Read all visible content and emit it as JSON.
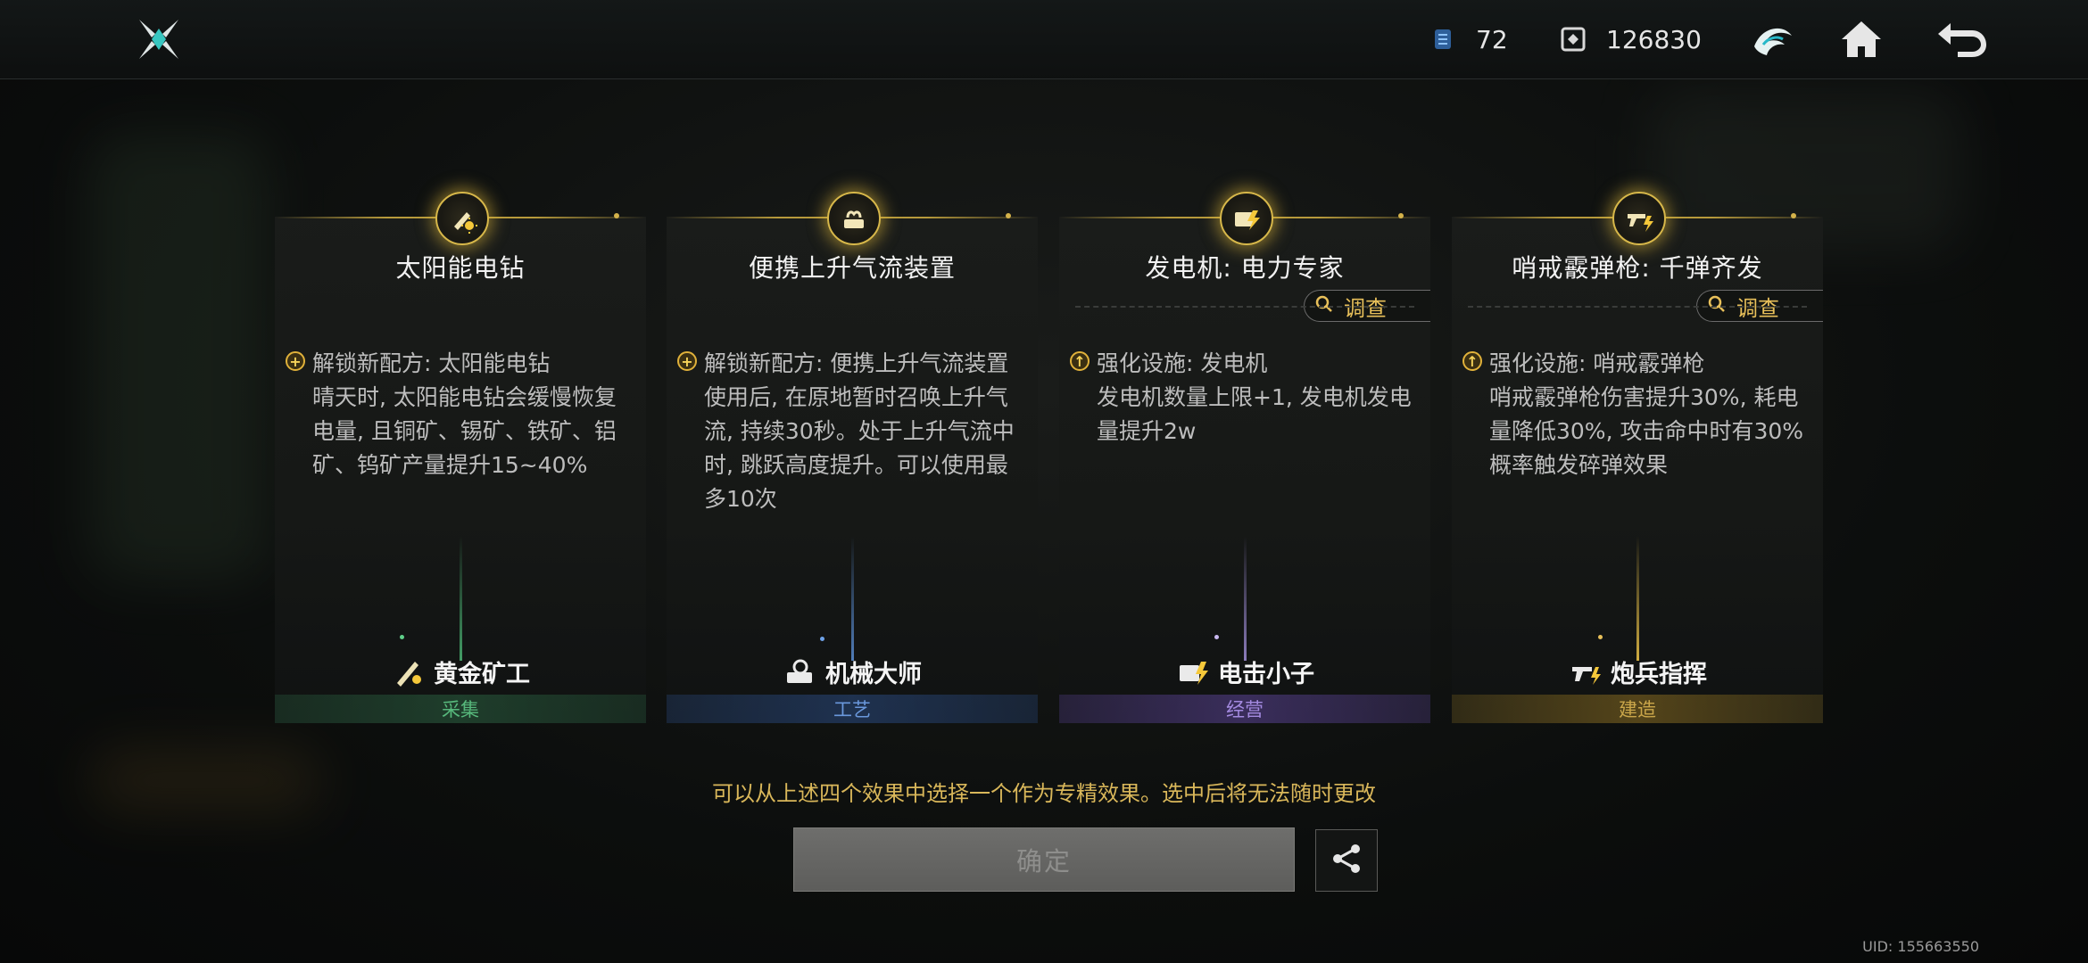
{
  "header": {
    "logo_icon": "crossed-blades-logo-icon",
    "resource_1": {
      "icon": "energy-chip-icon",
      "value": "72"
    },
    "resource_2": {
      "icon": "token-cube-icon",
      "value": "126830"
    },
    "mode_icon": "wave-emblem-icon",
    "home_icon": "home-icon",
    "back_icon": "back-arrow-icon"
  },
  "cards": [
    {
      "title": "太阳能电钻",
      "effect_head": "解锁新配方: 太阳能电钻",
      "effect_body": "晴天时, 太阳能电钻会缓慢恢复电量, 且铜矿、锡矿、铁矿、铝矿、钨矿产量提升15~40%",
      "profession": "黄金矿工",
      "category": "采集",
      "has_investigate": false,
      "accent": "#4fbf7a"
    },
    {
      "title": "便携上升气流装置",
      "effect_head": "解锁新配方: 便携上升气流装置",
      "effect_body": "使用后, 在原地暂时召唤上升气流, 持续30秒。处于上升气流中时, 跳跃高度提升。可以使用最多10次",
      "profession": "机械大师",
      "category": "工艺",
      "has_investigate": false,
      "accent": "#5b8fd6"
    },
    {
      "title": "发电机: 电力专家",
      "effect_head": "强化设施: 发电机",
      "effect_body": "发电机数量上限+1, 发电机发电量提升2w",
      "profession": "电击小子",
      "category": "经营",
      "has_investigate": true,
      "accent": "#8a6ad0"
    },
    {
      "title": "哨戒霰弹枪: 千弹齐发",
      "effect_head": "强化设施: 哨戒霰弹枪",
      "effect_body": "哨戒霰弹枪伤害提升30%, 耗电量降低30%, 攻击命中时有30%概率触发碎弹效果",
      "profession": "炮兵指挥",
      "category": "建造",
      "has_investigate": true,
      "accent": "#c9a23a"
    }
  ],
  "investigate_label": "调查",
  "notice": "可以从上述四个效果中选择一个作为专精效果。选中后将无法随时更改",
  "confirm_label": "确定",
  "uid_text": "UID: 155663550"
}
